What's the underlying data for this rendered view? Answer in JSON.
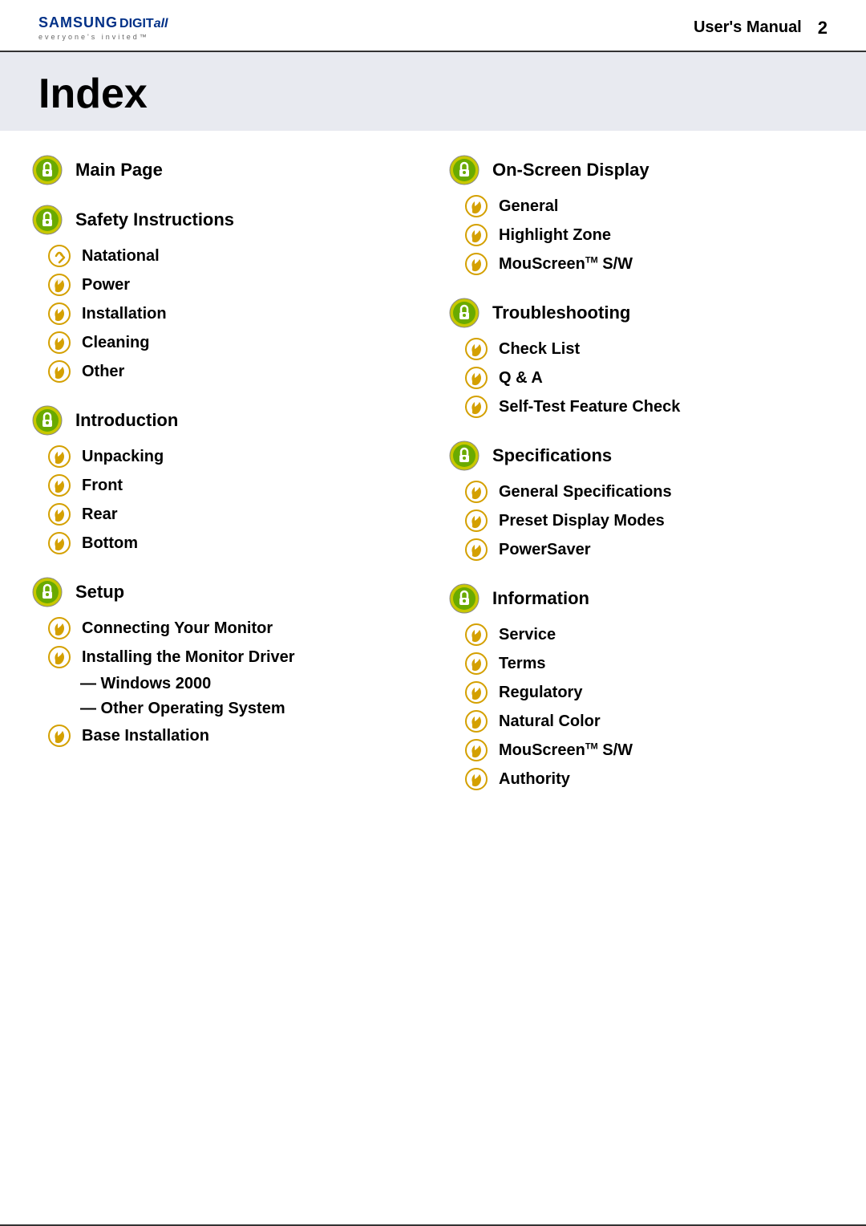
{
  "header": {
    "logo_brand": "SAMSUNG",
    "logo_digit": "DIGITall",
    "logo_tagline": "everyone's invited™",
    "title": "User's Manual",
    "page_number": "2"
  },
  "index": {
    "title": "Index"
  },
  "left_column": {
    "sections": [
      {
        "id": "main-page",
        "title": "Main Page",
        "items": []
      },
      {
        "id": "safety-instructions",
        "title": "Safety Instructions",
        "items": [
          {
            "id": "natational",
            "label": "Natational",
            "indent": false
          },
          {
            "id": "power",
            "label": "Power",
            "indent": false
          },
          {
            "id": "installation",
            "label": "Installation",
            "indent": false
          },
          {
            "id": "cleaning",
            "label": "Cleaning",
            "indent": false
          },
          {
            "id": "other",
            "label": "Other",
            "indent": false
          }
        ]
      },
      {
        "id": "introduction",
        "title": "Introduction",
        "items": [
          {
            "id": "unpacking",
            "label": "Unpacking",
            "indent": false
          },
          {
            "id": "front",
            "label": "Front",
            "indent": false
          },
          {
            "id": "rear",
            "label": "Rear",
            "indent": false
          },
          {
            "id": "bottom",
            "label": "Bottom",
            "indent": false
          }
        ]
      },
      {
        "id": "setup",
        "title": "Setup",
        "items": [
          {
            "id": "connecting-monitor",
            "label": "Connecting Your Monitor",
            "indent": false
          },
          {
            "id": "installing-driver",
            "label": "Installing the Monitor Driver",
            "indent": false
          },
          {
            "id": "windows-2000",
            "label": "— Windows 2000",
            "indent": true
          },
          {
            "id": "other-os",
            "label": "— Other Operating System",
            "indent": true
          },
          {
            "id": "base-installation",
            "label": "Base Installation",
            "indent": false
          }
        ]
      }
    ]
  },
  "right_column": {
    "sections": [
      {
        "id": "on-screen-display",
        "title": "On-Screen Display",
        "items": [
          {
            "id": "general",
            "label": "General",
            "indent": false
          },
          {
            "id": "highlight-zone",
            "label": "Highlight Zone",
            "indent": false
          },
          {
            "id": "mouscreen-sw-osd",
            "label": "MouScreen™ S/W",
            "indent": false
          }
        ]
      },
      {
        "id": "troubleshooting",
        "title": "Troubleshooting",
        "items": [
          {
            "id": "check-list",
            "label": "Check List",
            "indent": false
          },
          {
            "id": "qanda",
            "label": "Q & A",
            "indent": false
          },
          {
            "id": "self-test",
            "label": "Self-Test Feature Check",
            "indent": false
          }
        ]
      },
      {
        "id": "specifications",
        "title": "Specifications",
        "items": [
          {
            "id": "general-specs",
            "label": "General Specifications",
            "indent": false
          },
          {
            "id": "preset-display",
            "label": "Preset Display Modes",
            "indent": false
          },
          {
            "id": "powersaver",
            "label": "PowerSaver",
            "indent": false
          }
        ]
      },
      {
        "id": "information",
        "title": "Information",
        "items": [
          {
            "id": "service",
            "label": "Service",
            "indent": false
          },
          {
            "id": "terms",
            "label": "Terms",
            "indent": false
          },
          {
            "id": "regulatory",
            "label": "Regulatory",
            "indent": false
          },
          {
            "id": "natural-color",
            "label": "Natural Color",
            "indent": false
          },
          {
            "id": "mouscreen-sw-info",
            "label": "MouScreen™ S/W",
            "indent": false
          },
          {
            "id": "authority",
            "label": "Authority",
            "indent": false
          }
        ]
      }
    ]
  }
}
